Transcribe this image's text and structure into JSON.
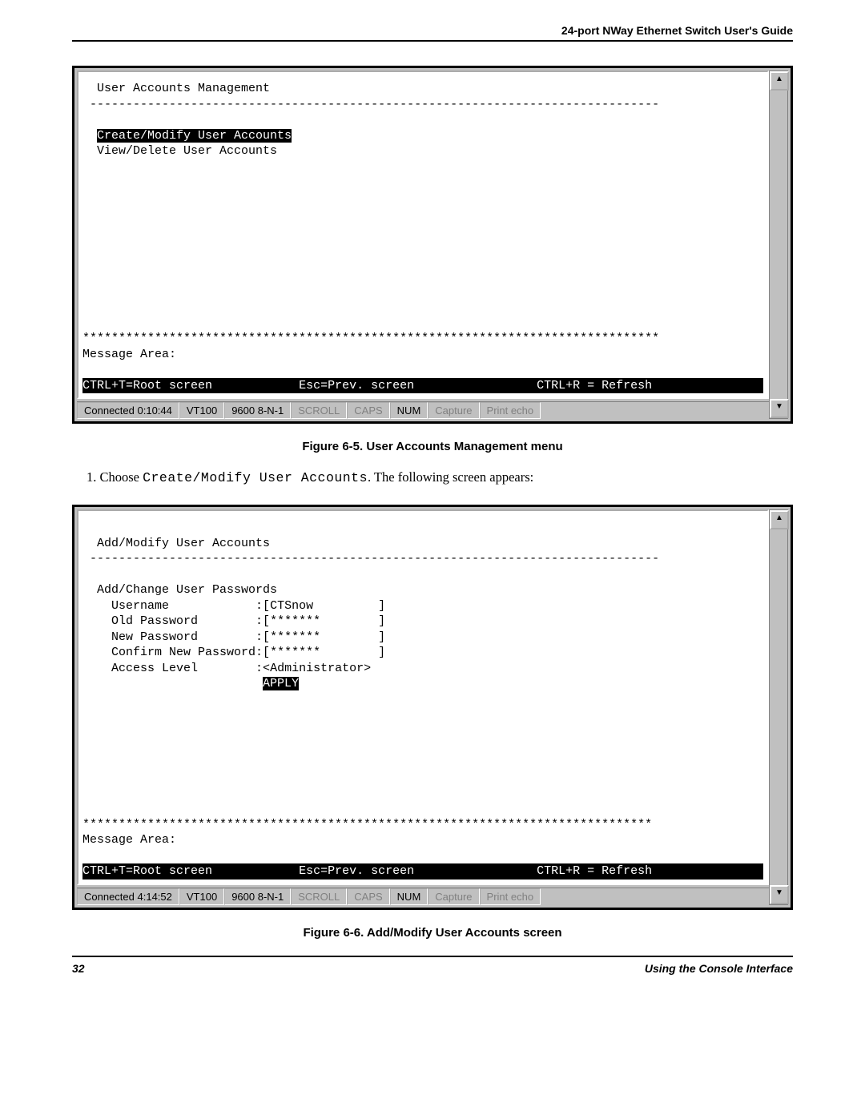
{
  "header": {
    "title": "24-port NWay Ethernet Switch User's Guide"
  },
  "terminal1": {
    "title": "User Accounts Management",
    "dashline": "-------------------------------------------------------------------------------",
    "menu_create": "Create/Modify User Accounts",
    "menu_view": "View/Delete User Accounts",
    "stars": "********************************************************************************",
    "msg_label": "Message Area:",
    "nav_root": "CTRL+T=Root screen",
    "nav_prev": "Esc=Prev. screen",
    "nav_refresh": "CTRL+R = Refresh"
  },
  "status1": {
    "connected": "Connected 0:10:44",
    "emulation": "VT100",
    "params": "9600 8-N-1",
    "scroll": "SCROLL",
    "caps": "CAPS",
    "num": "NUM",
    "capture": "Capture",
    "print": "Print echo"
  },
  "figure1": "Figure 6-5.  User Accounts Management menu",
  "instruction1_prefix": "1.  Choose ",
  "instruction1_choice": "Create/Modify User Accounts",
  "instruction1_suffix": ". The following screen appears:",
  "terminal2": {
    "title": "Add/Modify User Accounts",
    "dashline": "-------------------------------------------------------------------------------",
    "section": "Add/Change User Passwords",
    "field_username_label": "Username",
    "field_username_value": "CTSnow",
    "field_oldpw_label": "Old Password",
    "field_oldpw_value": "*******",
    "field_newpw_label": "New Password",
    "field_newpw_value": "*******",
    "field_confirm_label": "Confirm New Password",
    "field_confirm_value": "*******",
    "field_access_label": "Access Level",
    "field_access_value": "Administrator",
    "apply": "APPLY",
    "stars": "*******************************************************************************",
    "msg_label": "Message Area:",
    "nav_root": "CTRL+T=Root screen",
    "nav_prev": "Esc=Prev. screen",
    "nav_refresh": "CTRL+R = Refresh"
  },
  "status2": {
    "connected": "Connected 4:14:52",
    "emulation": "VT100",
    "params": "9600 8-N-1",
    "scroll": "SCROLL",
    "caps": "CAPS",
    "num": "NUM",
    "capture": "Capture",
    "print": "Print echo"
  },
  "figure2": "Figure 6-6.  Add/Modify User Accounts screen",
  "footer": {
    "page": "32",
    "section": "Using the Console Interface"
  }
}
